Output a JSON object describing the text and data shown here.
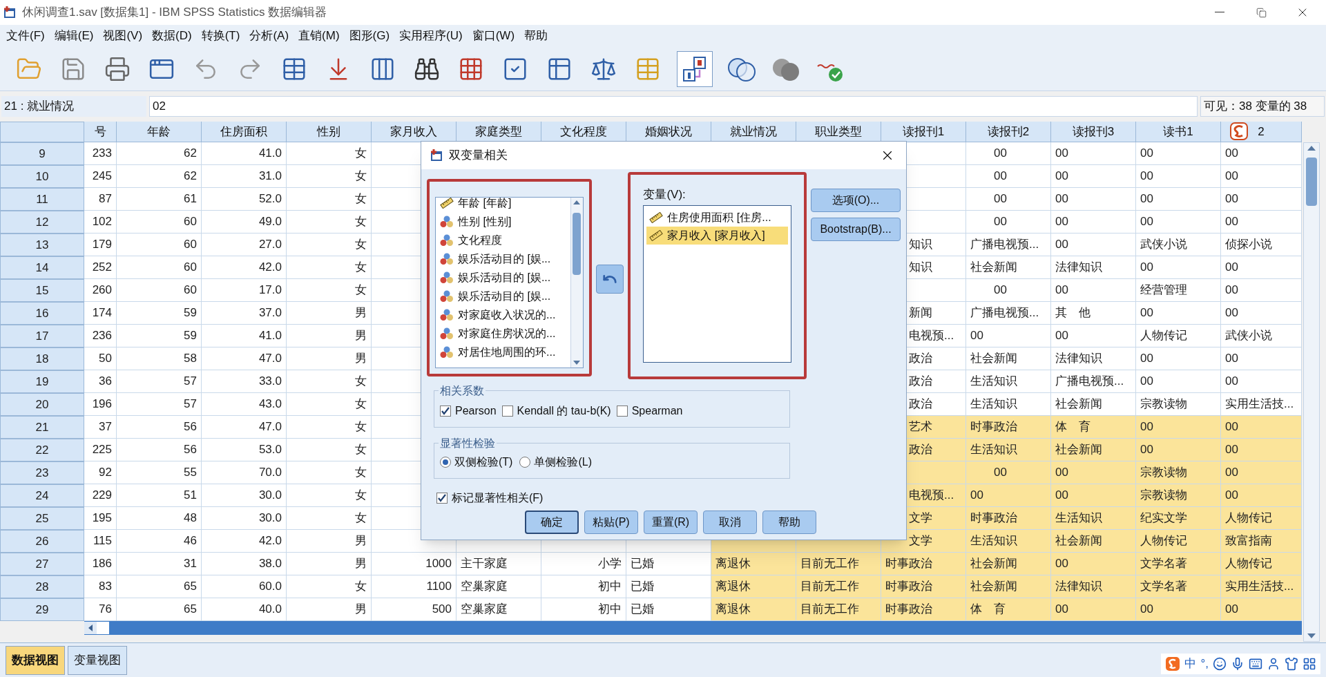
{
  "window": {
    "title": "休闲调查1.sav [数据集1] - IBM SPSS Statistics 数据编辑器"
  },
  "menu": [
    "文件(F)",
    "编辑(E)",
    "视图(V)",
    "数据(D)",
    "转换(T)",
    "分析(A)",
    "直销(M)",
    "图形(G)",
    "实用程序(U)",
    "窗口(W)",
    "帮助"
  ],
  "toolbar": {
    "value_labels_pressed": true
  },
  "cell_bar": {
    "cell": "21 : 就业情况",
    "value": "02",
    "visible": "可见：38 变量的 38"
  },
  "table": {
    "columns": [
      {
        "label": "号"
      },
      {
        "label": "年龄"
      },
      {
        "label": "住房面积"
      },
      {
        "label": "性别"
      },
      {
        "label": "家月收入"
      },
      {
        "label": "家庭类型"
      },
      {
        "label": "文化程度"
      },
      {
        "label": "婚姻状况"
      },
      {
        "label": "就业情况"
      },
      {
        "label": "职业类型"
      },
      {
        "label": "读报刊1"
      },
      {
        "label": "读报刊2"
      },
      {
        "label": "读报刊3"
      },
      {
        "label": "读书1"
      },
      {
        "label": "2"
      }
    ],
    "rows": [
      {
        "number": "9",
        "highlighted": false,
        "cells": [
          "233",
          "62",
          "41.0",
          "女",
          null,
          null,
          null,
          null,
          null,
          null,
          null,
          "00",
          "00",
          "00",
          "00"
        ]
      },
      {
        "number": "10",
        "highlighted": false,
        "cells": [
          "245",
          "62",
          "31.0",
          "女",
          null,
          null,
          null,
          null,
          null,
          null,
          null,
          "00",
          "00",
          "00",
          "00"
        ]
      },
      {
        "number": "11",
        "highlighted": false,
        "cells": [
          "87",
          "61",
          "52.0",
          "女",
          null,
          null,
          null,
          null,
          null,
          null,
          null,
          "00",
          "00",
          "00",
          "00"
        ]
      },
      {
        "number": "12",
        "highlighted": false,
        "cells": [
          "102",
          "60",
          "49.0",
          "女",
          null,
          null,
          null,
          null,
          null,
          null,
          null,
          "00",
          "00",
          "00",
          "00"
        ]
      },
      {
        "number": "13",
        "highlighted": false,
        "cells": [
          "179",
          "60",
          "27.0",
          "女",
          null,
          null,
          null,
          null,
          null,
          null,
          "知识",
          "广播电视预...",
          "00",
          "武侠小说",
          "侦探小说"
        ]
      },
      {
        "number": "14",
        "highlighted": false,
        "cells": [
          "252",
          "60",
          "42.0",
          "女",
          null,
          null,
          null,
          null,
          null,
          null,
          "知识",
          "社会新闻",
          "法律知识",
          "00",
          "00"
        ]
      },
      {
        "number": "15",
        "highlighted": false,
        "cells": [
          "260",
          "60",
          "17.0",
          "女",
          null,
          null,
          null,
          null,
          null,
          null,
          null,
          "00",
          "00",
          "经营管理",
          "00"
        ]
      },
      {
        "number": "16",
        "highlighted": false,
        "cells": [
          "174",
          "59",
          "37.0",
          "男",
          null,
          null,
          null,
          null,
          null,
          null,
          "新闻",
          "广播电视预...",
          "其　他",
          "00",
          "00"
        ]
      },
      {
        "number": "17",
        "highlighted": false,
        "cells": [
          "236",
          "59",
          "41.0",
          "男",
          null,
          null,
          null,
          null,
          null,
          null,
          "电视预...",
          "00",
          "00",
          "人物传记",
          "武侠小说"
        ]
      },
      {
        "number": "18",
        "highlighted": false,
        "cells": [
          "50",
          "58",
          "47.0",
          "男",
          null,
          null,
          null,
          null,
          null,
          null,
          "政治",
          "社会新闻",
          "法律知识",
          "00",
          "00"
        ]
      },
      {
        "number": "19",
        "highlighted": false,
        "cells": [
          "36",
          "57",
          "33.0",
          "女",
          null,
          null,
          null,
          null,
          null,
          null,
          "政治",
          "生活知识",
          "广播电视预...",
          "00",
          "00"
        ]
      },
      {
        "number": "20",
        "highlighted": false,
        "cells": [
          "196",
          "57",
          "43.0",
          "女",
          null,
          null,
          null,
          null,
          null,
          null,
          "政治",
          "生活知识",
          "社会新闻",
          "宗教读物",
          "实用生活技..."
        ]
      },
      {
        "number": "21",
        "highlighted": true,
        "cells": [
          "37",
          "56",
          "47.0",
          "女",
          null,
          null,
          null,
          null,
          null,
          null,
          "艺术",
          "时事政治",
          "体　育",
          "00",
          "00"
        ]
      },
      {
        "number": "22",
        "highlighted": true,
        "cells": [
          "225",
          "56",
          "53.0",
          "女",
          null,
          null,
          null,
          null,
          null,
          null,
          "政治",
          "生活知识",
          "社会新闻",
          "00",
          "00"
        ]
      },
      {
        "number": "23",
        "highlighted": true,
        "cells": [
          "92",
          "55",
          "70.0",
          "女",
          null,
          null,
          null,
          null,
          null,
          null,
          null,
          "00",
          "00",
          "宗教读物",
          "00"
        ]
      },
      {
        "number": "24",
        "highlighted": true,
        "cells": [
          "229",
          "51",
          "30.0",
          "女",
          null,
          null,
          null,
          null,
          null,
          null,
          "电视预...",
          "00",
          "00",
          "宗教读物",
          "00"
        ]
      },
      {
        "number": "25",
        "highlighted": true,
        "cells": [
          "195",
          "48",
          "30.0",
          "女",
          null,
          null,
          null,
          null,
          null,
          null,
          "文学",
          "时事政治",
          "生活知识",
          "纪实文学",
          "人物传记"
        ]
      },
      {
        "number": "26",
        "highlighted": true,
        "cells": [
          "115",
          "46",
          "42.0",
          "男",
          null,
          null,
          null,
          null,
          null,
          null,
          "文学",
          "生活知识",
          "社会新闻",
          "人物传记",
          "致富指南"
        ]
      },
      {
        "number": "27",
        "highlighted": true,
        "cells": [
          "186",
          "31",
          "38.0",
          "男",
          "1000",
          "主干家庭",
          "小学",
          "已婚",
          "离退休",
          "目前无工作",
          "时事政治",
          "社会新闻",
          "00",
          "文学名著",
          "人物传记"
        ]
      },
      {
        "number": "28",
        "highlighted": true,
        "cells": [
          "83",
          "65",
          "60.0",
          "女",
          "1100",
          "空巢家庭",
          "初中",
          "已婚",
          "离退休",
          "目前无工作",
          "时事政治",
          "社会新闻",
          "法律知识",
          "文学名著",
          "实用生活技..."
        ]
      },
      {
        "number": "29",
        "highlighted": true,
        "cells": [
          "76",
          "65",
          "40.0",
          "男",
          "500",
          "空巢家庭",
          "初中",
          "已婚",
          "离退休",
          "目前无工作",
          "时事政治",
          "体　育",
          "00",
          "00",
          "00"
        ]
      }
    ]
  },
  "view_tabs": [
    {
      "label": "数据视图",
      "selected": true
    },
    {
      "label": "变量视图",
      "selected": false
    }
  ],
  "ime_bar": {
    "mode": "中",
    "punctuation": "°,"
  },
  "dialog": {
    "title": "双变量相关",
    "source_variables": [
      {
        "label": "年龄 [年龄]",
        "kind": "scale"
      },
      {
        "label": "性别 [性别]",
        "kind": "nominal"
      },
      {
        "label": "文化程度",
        "kind": "nominal"
      },
      {
        "label": "娱乐活动目的 [娱...",
        "kind": "nominal"
      },
      {
        "label": "娱乐活动目的 [娱...",
        "kind": "nominal"
      },
      {
        "label": "娱乐活动目的 [娱...",
        "kind": "nominal"
      },
      {
        "label": "对家庭收入状况的...",
        "kind": "nominal"
      },
      {
        "label": "对家庭住房状况的...",
        "kind": "nominal"
      },
      {
        "label": "对居住地周围的环...",
        "kind": "nominal"
      }
    ],
    "target_label": "变量(V):",
    "target_variables": [
      {
        "label": "住房使用面积 [住房...",
        "kind": "scale",
        "selected": false
      },
      {
        "label": "家月收入 [家月收入]",
        "kind": "scale",
        "selected": true
      }
    ],
    "side_buttons": [
      "选项(O)...",
      "Bootstrap(B)..."
    ],
    "coefficients": {
      "title": "相关系数",
      "options": [
        {
          "label": "Pearson",
          "checked": true
        },
        {
          "label": "Kendall 的 tau-b(K)",
          "checked": false
        },
        {
          "label": "Spearman",
          "checked": false
        }
      ]
    },
    "test": {
      "title": "显著性检验",
      "options": [
        {
          "label": "双侧检验(T)",
          "selected": true
        },
        {
          "label": "单侧检验(L)",
          "selected": false
        }
      ]
    },
    "flag": {
      "label": "标记显著性相关(F)",
      "checked": true
    },
    "buttons": [
      {
        "label": "确定",
        "default": true
      },
      {
        "label": "粘贴(P)",
        "default": false
      },
      {
        "label": "重置(R)",
        "default": false
      },
      {
        "label": "取消",
        "default": false
      },
      {
        "label": "帮助",
        "default": false
      }
    ]
  }
}
